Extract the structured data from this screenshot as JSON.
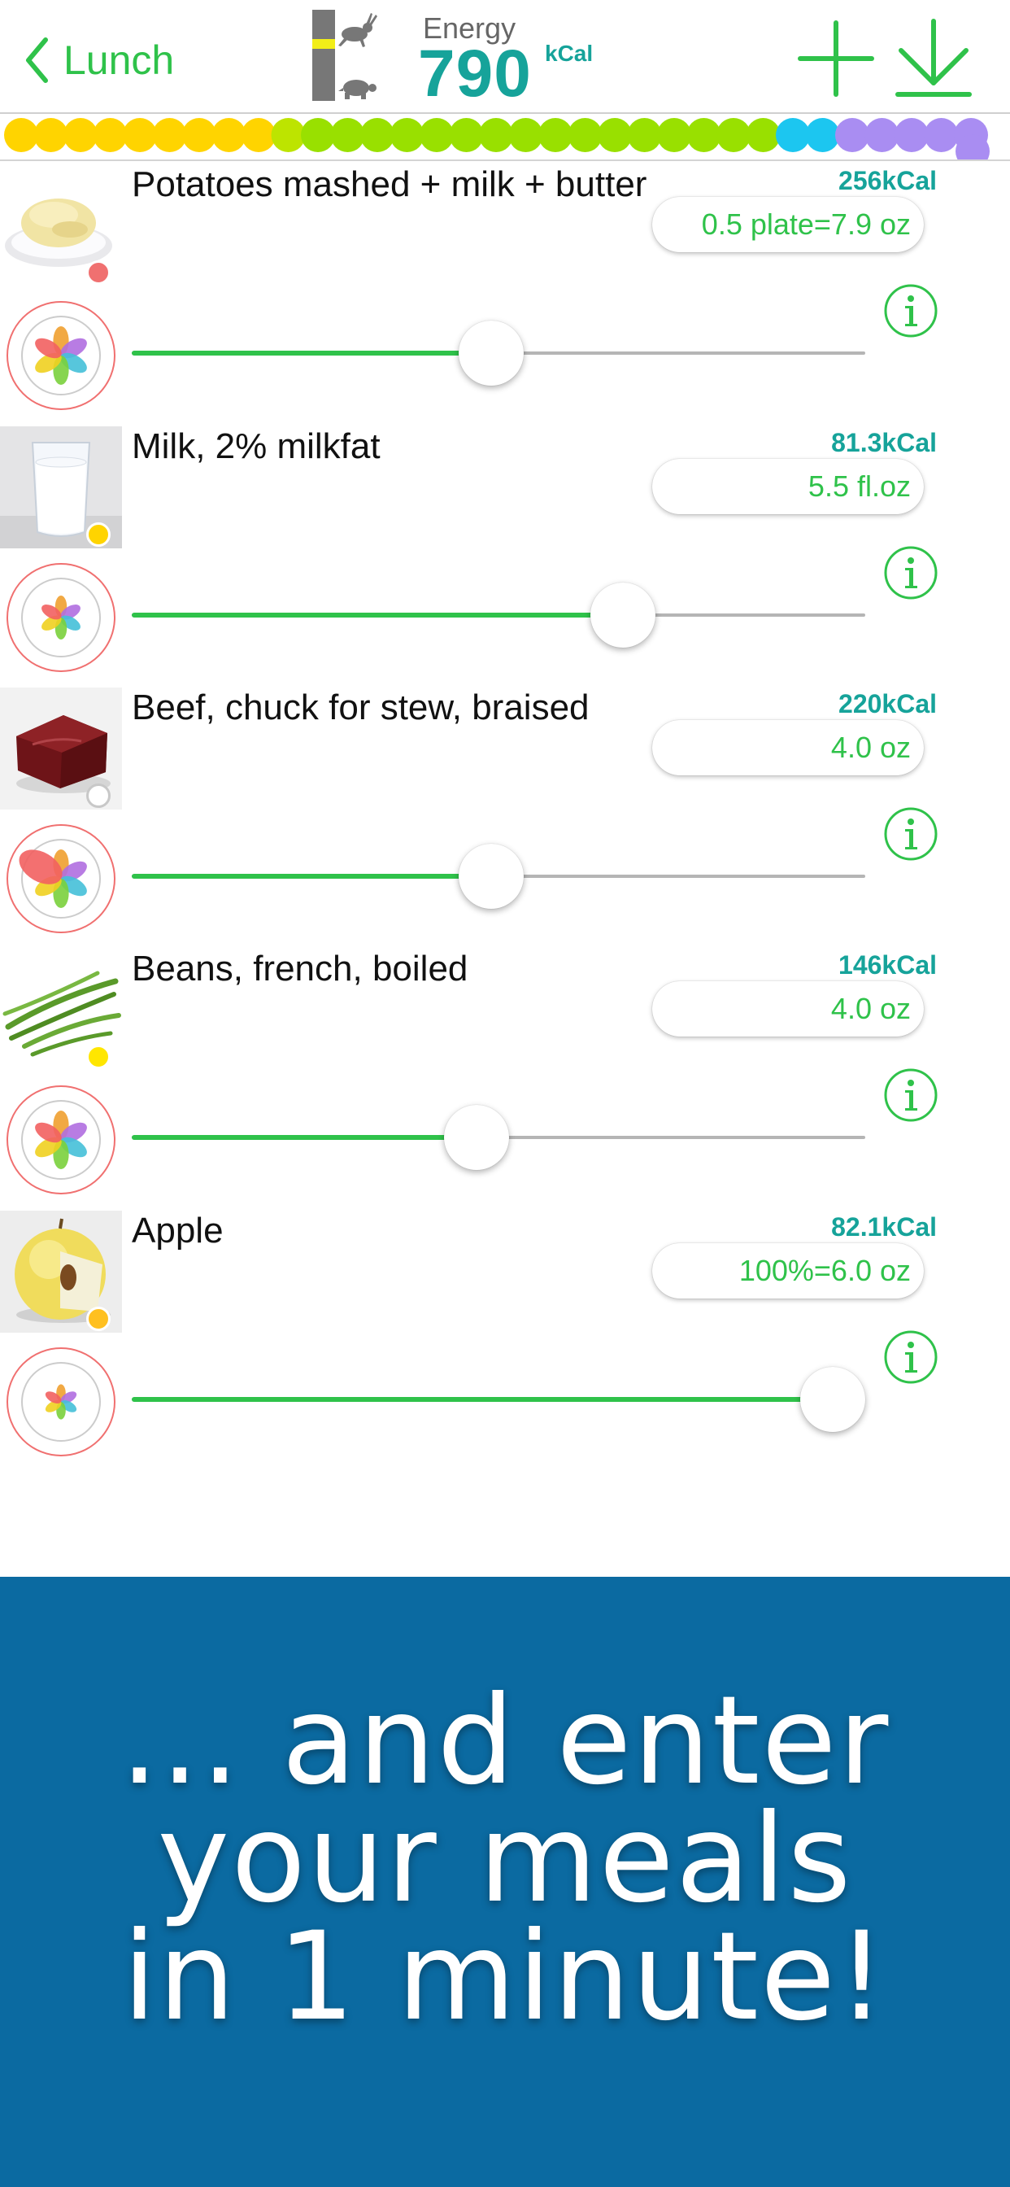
{
  "header": {
    "back_label": "Lunch",
    "energy_label": "Energy",
    "energy_value": "790",
    "energy_unit": "kCal",
    "icons": [
      "chevron-left-icon",
      "speed-gauge-icon",
      "rabbit-icon",
      "turtle-icon",
      "add-icon",
      "download-icon"
    ]
  },
  "colors": {
    "accent_green": "#2fc24a",
    "kcal_teal": "#16a39a",
    "banner_blue": "#0b6aa1"
  },
  "dot_strip": {
    "colors": [
      "#ffd400",
      "#ffd400",
      "#ffd400",
      "#ffd400",
      "#ffd400",
      "#ffd400",
      "#ffd400",
      "#ffd400",
      "#ffd400",
      "#bde400",
      "#99e000",
      "#99e000",
      "#99e000",
      "#99e000",
      "#99e000",
      "#99e000",
      "#99e000",
      "#99e000",
      "#99e000",
      "#99e000",
      "#99e000",
      "#99e000",
      "#99e000",
      "#99e000",
      "#99e000",
      "#99e000",
      "#1cc6f0",
      "#1cc6f0",
      "#a98df2",
      "#a98df2",
      "#a98df2",
      "#a98df2",
      "#a98df2"
    ]
  },
  "foods": [
    {
      "name": "Potatoes mashed + milk + butter",
      "kcal": "256kCal",
      "portion": "0.5 plate=7.9 oz",
      "slider_fraction": 0.49,
      "status_color": "#f07070",
      "image": "mashed-potatoes"
    },
    {
      "name": "Milk, 2% milkfat",
      "kcal": "81.3kCal",
      "portion": "5.5 fl.oz",
      "slider_fraction": 0.67,
      "status_color": "#ffd400",
      "image": "milk-glass"
    },
    {
      "name": "Beef, chuck for stew, braised",
      "kcal": "220kCal",
      "portion": "4.0 oz",
      "slider_fraction": 0.49,
      "status_color": "none",
      "image": "beef"
    },
    {
      "name": "Beans, french, boiled",
      "kcal": "146kCal",
      "portion": "4.0 oz",
      "slider_fraction": 0.47,
      "status_color": "#ffe600",
      "image": "green-beans"
    },
    {
      "name": "Apple",
      "kcal": "82.1kCal",
      "portion": "100%=6.0 oz",
      "slider_fraction": 0.96,
      "status_color": "#ffc020",
      "image": "apple"
    }
  ],
  "banner": {
    "lines": [
      "... and enter",
      "your meals",
      "in 1 minute!"
    ]
  }
}
